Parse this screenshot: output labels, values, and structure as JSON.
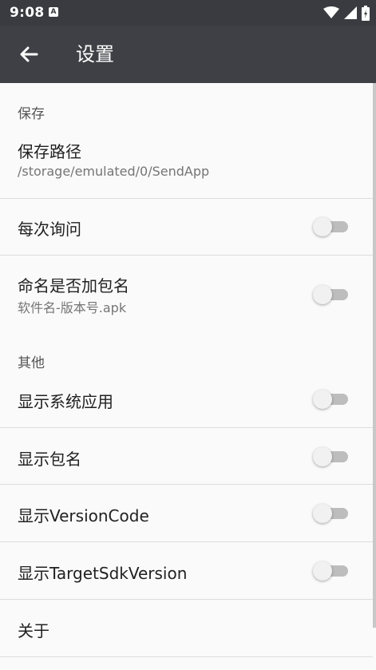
{
  "status_bar": {
    "time": "9:08",
    "notification_badge": "A",
    "icons": [
      "wifi-icon",
      "signal-icon",
      "battery-icon"
    ]
  },
  "toolbar": {
    "back_icon": "arrow-left-icon",
    "title": "设置"
  },
  "sections": {
    "save": {
      "header": "保存",
      "path_title": "保存路径",
      "path_value": "/storage/emulated/0/SendApp",
      "ask_each_time": "每次询问",
      "append_package": "命名是否加包名",
      "append_package_summary": "软件名-版本号.apk"
    },
    "other": {
      "header": "其他",
      "show_system_apps": "显示系统应用",
      "show_package_name": "显示包名",
      "show_version_code": "显示VersionCode",
      "show_target_sdk": "显示TargetSdkVersion",
      "about": "关于"
    }
  },
  "toggles": {
    "ask_each_time": false,
    "append_package": false,
    "show_system_apps": false,
    "show_package_name": false,
    "show_version_code": false,
    "show_target_sdk": false
  },
  "colors": {
    "toolbar_bg": "#3f4045",
    "status_bar_bg": "#3a3b40",
    "background": "#fafafa",
    "switch_track_off": "#bdbdbd",
    "switch_thumb_off": "#f1f1f1"
  }
}
